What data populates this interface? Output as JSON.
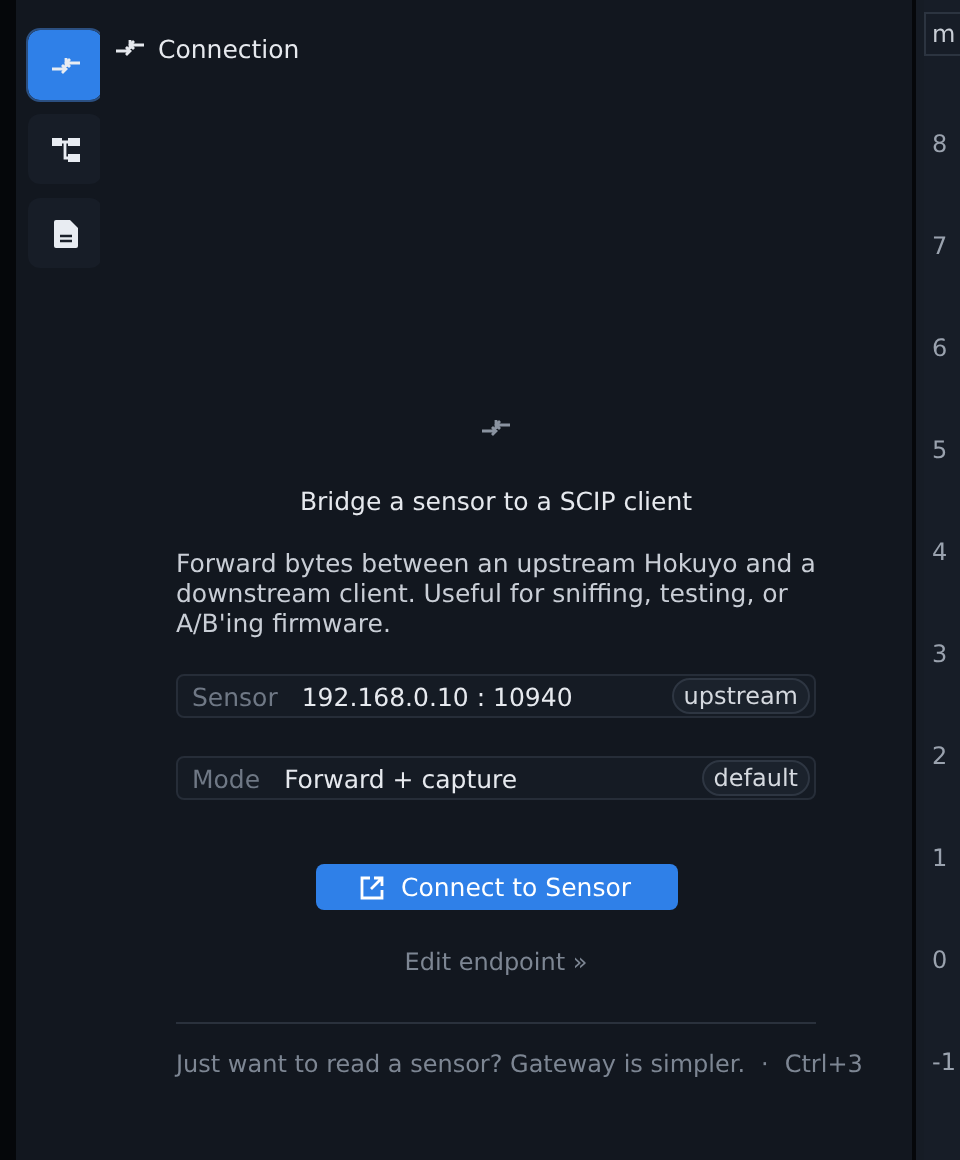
{
  "sidebar": {
    "items": [
      {
        "kind": "connection",
        "selected": true
      },
      {
        "kind": "tree",
        "selected": false
      },
      {
        "kind": "document",
        "selected": false
      }
    ]
  },
  "header": {
    "title": "Connection"
  },
  "empty_state": {
    "title": "Bridge a sensor to a SCIP client",
    "description": "Forward bytes between an upstream Hokuyo and a downstream client. Useful for sniffing, testing, or A/B'ing firmware.",
    "fields": [
      {
        "label": "Sensor",
        "value": "192.168.0.10 : 10940",
        "badge": "upstream"
      },
      {
        "label": "Mode",
        "value": "Forward + capture",
        "badge": "default"
      }
    ],
    "primary_button": "Connect to Sensor",
    "link": "Edit endpoint »",
    "footer_text": "Just want to read a sensor? Gateway is simpler.",
    "footer_separator": "·",
    "footer_shortcut": "Ctrl+3"
  },
  "side_panel": {
    "header": "m",
    "axis_labels": [
      "8",
      "7",
      "6",
      "5",
      "4",
      "3",
      "2",
      "1",
      "0",
      "-1"
    ]
  }
}
